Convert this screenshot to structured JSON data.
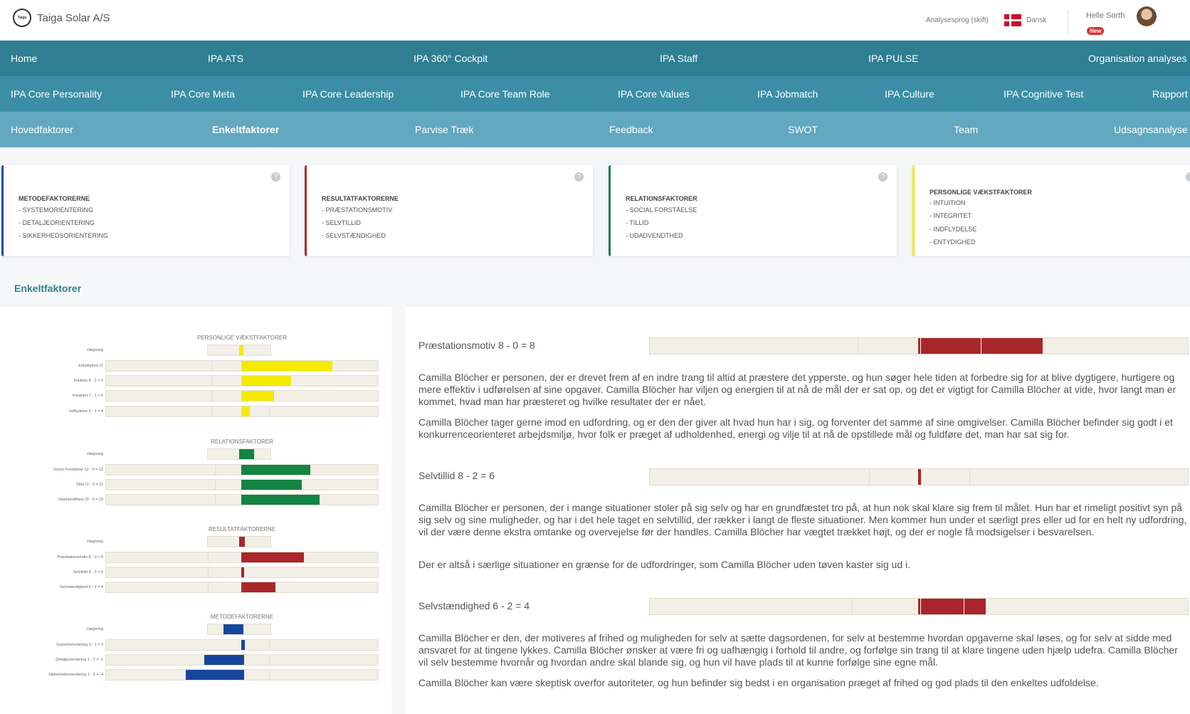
{
  "header": {
    "logo_text": "Taiga",
    "company": "Taiga Solar A/S",
    "language_label": "Analysesprog (skift)",
    "language": "Dansk",
    "user_name": "Helle Sorth",
    "badge": "New"
  },
  "nav_primary": [
    "Home",
    "IPA ATS",
    "IPA 360° Cockpit",
    "IPA Staff",
    "IPA PULSE",
    "Organisation analyses"
  ],
  "nav_secondary": [
    "IPA Core Personality",
    "IPA Core Meta",
    "IPA Core Leadership",
    "IPA Core Team Role",
    "IPA Core Values",
    "IPA Jobmatch",
    "IPA Culture",
    "IPA Cognitive Test",
    "Rapport"
  ],
  "nav_tertiary": [
    "Hovedfaktorer",
    "Enkeltfaktorer",
    "Parvise Træk",
    "Feedback",
    "SWOT",
    "Team",
    "Udsagnsanalyse"
  ],
  "nav_tertiary_active": "Enkeltfaktorer",
  "cards": [
    {
      "title": "METODEFAKTORERNE",
      "items": [
        "- SYSTEMORIENTERING",
        "- DETALJEORIENTERING",
        "- SIKKERHEDSORIENTERING"
      ],
      "accent": "#1f4e9c"
    },
    {
      "title": "RESULTATFAKTORERNE",
      "items": [
        "- PRÆSTATIONSMOTIV",
        "- SELVTILLID",
        "- SELVSTÆNDIGHED"
      ],
      "accent": "#b02a30"
    },
    {
      "title": "RELATIONSFAKTORER",
      "items": [
        "- SOCIAL FORSTÅELSE",
        "- TILLID",
        "- UDADVENDTHED"
      ],
      "accent": "#168043"
    },
    {
      "title": "PERSONLIGE VÆKSTFAKTORER",
      "items": [
        "- INTUITION",
        "- INTEGRITET",
        "- INDFLYDELSE",
        "- ENTYDIGHED"
      ],
      "accent": "#f3e81a"
    }
  ],
  "left_panel": {
    "title": "Enkeltfaktorer",
    "groups": [
      {
        "title": "PERSONLIGE VÆKSTFAKTORER",
        "color": "#f5ea00",
        "weight_label": "Vægtning",
        "rows": [
          "Entydighed 11",
          "Intuition 8 - 2 = 6",
          "Integritet 7 - 1 = 6",
          "Indflydelse 5 - 1 = 4"
        ]
      },
      {
        "title": "RELATIONSFAKTORER",
        "color": "#138442",
        "weight_label": "Vægtning",
        "rows": [
          "Social Forståelse 12 - 0 = 12",
          "Tillid 11 - 0 = 11",
          "Udadvendthed 10 - 0 = 10"
        ]
      },
      {
        "title": "RESULTATFAKTORERNE",
        "color": "#a9262b",
        "weight_label": "Vægtning",
        "rows": [
          "Præstationsmotiv 8 - 0 = 8",
          "Selvtillid 8 - 2 = 6",
          "Selvstændighed 6 - 2 = 4"
        ]
      },
      {
        "title": "METODEFAKTORERNE",
        "color": "#16479c",
        "weight_label": "Vægtning",
        "rows": [
          "Systemorientering 3 - 1 = 2",
          "Detaljeorientering 1 - 2 = -1",
          "Sikkerhedsorientering 1 - 5 = -4"
        ]
      }
    ]
  },
  "sections": [
    {
      "label": "Præstationsmotiv 8 - 0 = 8",
      "paragraphs": [
        "Camilla Blöcher er personen, der er drevet frem af en indre trang til altid at præstere det ypperste, og hun søger hele tiden at forbedre sig for at blive dygtigere, hurtigere og mere effektiv i udførelsen af sine opgaver. Camilla Blöcher har viljen og energien til at nå de mål der er sat op, og det er vigtigt for Camilla Blöcher at vide, hvor langt man er kommet, hvad man har præsteret og hvilke resultater der er nået.",
        "Camilla Blöcher tager gerne imod en udfordring, og er den der giver alt hvad hun har i sig, og forventer det samme af sine omgivelser. Camilla Blöcher befinder sig godt i et konkurrenceorienteret arbejdsmiljø, hvor folk er præget af udholdenhed, energi og vilje til at nå de opstillede mål og fuldføre det, man har sat sig for."
      ]
    },
    {
      "label": "Selvtillid 8 - 2 = 6",
      "paragraphs": [
        "Camilla Blöcher er personen, der i mange situationer stoler på sig selv og har en grundfæstet tro på, at hun nok skal klare sig frem til målet. Hun har et rimeligt positivt syn på sig selv og sine muligheder, og har i det hele taget en selvtillid, der rækker i langt de fleste situationer. Men kommer hun under et særligt pres eller ud for en helt ny udfordring, vil der være denne ekstra omtanke og overvejelse før der handles. Camilla Blöcher har vægtet trækket højt, og der er nogle få modsigelser i besvarelsen.",
        "Der er altså i særlige situationer en grænse for de udfordringer, som Camilla Blöcher uden tøven kaster sig ud i."
      ]
    },
    {
      "label": "Selvstændighed 6 - 2 = 4",
      "paragraphs": [
        "Camilla Blöcher er den, der motiveres af frihed og muligheden for selv at sætte dagsordenen, for selv at bestemme hvordan opgaverne skal løses, og for selv at sidde med ansvaret for at tingene lykkes. Camilla Blöcher ønsker at være fri og uafhængig i forhold til andre, og forfølge sin trang til at klare tingene uden hjælp udefra. Camilla Blöcher vil selv bestemme hvornår og hvordan andre skal blande sig, og hun vil have plads til at kunne forfølge sine egne mål.",
        "Camilla Blöcher kan være skeptisk overfor autoriteter, og hun befinder sig bedst i en organisation præget af frihed og god plads til den enkeltes udfoldelse."
      ]
    }
  ]
}
